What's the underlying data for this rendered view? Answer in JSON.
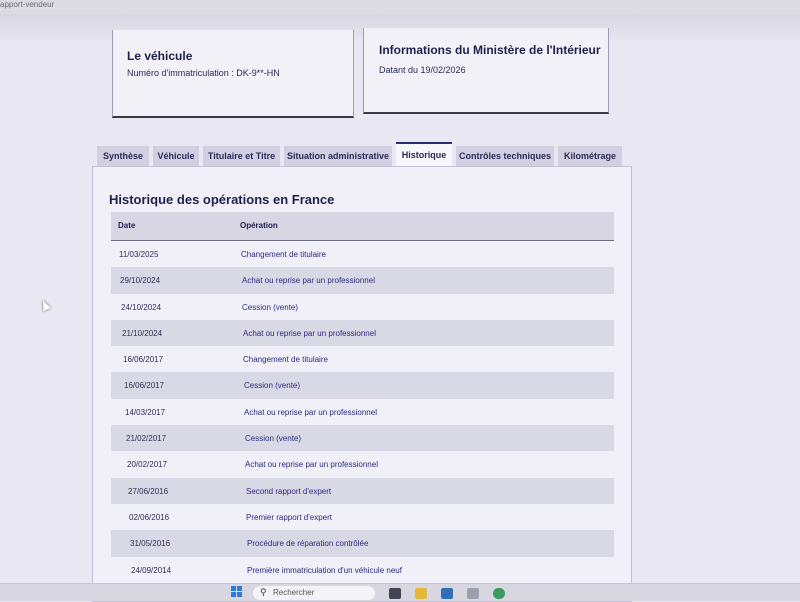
{
  "browser": {
    "url_fragment": "apport-vendeur"
  },
  "vehicle_card": {
    "title": "Le véhicule",
    "registration": "Numéro d'immatriculation : DK-9**-HN"
  },
  "ministry_card": {
    "title": "Informations du Ministère de l'Intérieur",
    "dated": "Datant du 19/02/2026"
  },
  "tabs": [
    {
      "label": "Synthèse",
      "active": false
    },
    {
      "label": "Véhicule",
      "active": false
    },
    {
      "label": "Titulaire et Titre",
      "active": false
    },
    {
      "label": "Situation administrative",
      "active": false
    },
    {
      "label": "Historique",
      "active": true
    },
    {
      "label": "Contrôles techniques",
      "active": false
    },
    {
      "label": "Kilométrage",
      "active": false
    }
  ],
  "history": {
    "title": "Historique des opérations en France",
    "columns": {
      "date": "Date",
      "operation": "Opération"
    },
    "rows": [
      {
        "date": "11/03/2025",
        "operation": "Changement de titulaire"
      },
      {
        "date": "29/10/2024",
        "operation": "Achat ou reprise par un professionnel"
      },
      {
        "date": "24/10/2024",
        "operation": "Cession (vente)"
      },
      {
        "date": "21/10/2024",
        "operation": "Achat ou reprise par un professionnel"
      },
      {
        "date": "16/06/2017",
        "operation": "Changement de titulaire"
      },
      {
        "date": "16/06/2017",
        "operation": "Cession (vente)"
      },
      {
        "date": "14/03/2017",
        "operation": "Achat ou reprise par un professionnel"
      },
      {
        "date": "21/02/2017",
        "operation": "Cession (vente)"
      },
      {
        "date": "20/02/2017",
        "operation": "Achat ou reprise par un professionnel"
      },
      {
        "date": "27/06/2016",
        "operation": "Second rapport d'expert"
      },
      {
        "date": "02/06/2016",
        "operation": "Premier rapport d'expert"
      },
      {
        "date": "31/05/2016",
        "operation": "Procédure de réparation contrôlée"
      },
      {
        "date": "24/09/2014",
        "operation": "Première immatriculation d'un véhicule neuf"
      }
    ]
  },
  "taskbar": {
    "search_label": "Rechercher",
    "search_icon": "search-icon",
    "apps": [
      {
        "name": "file-manager-icon",
        "color": "#444455"
      },
      {
        "name": "folder-icon",
        "color": "#e6b83a"
      },
      {
        "name": "calculator-icon",
        "color": "#2f6fb8"
      },
      {
        "name": "window-icon",
        "color": "#9aa0b0"
      },
      {
        "name": "browser-icon",
        "color": "#3a9b5c"
      }
    ]
  }
}
